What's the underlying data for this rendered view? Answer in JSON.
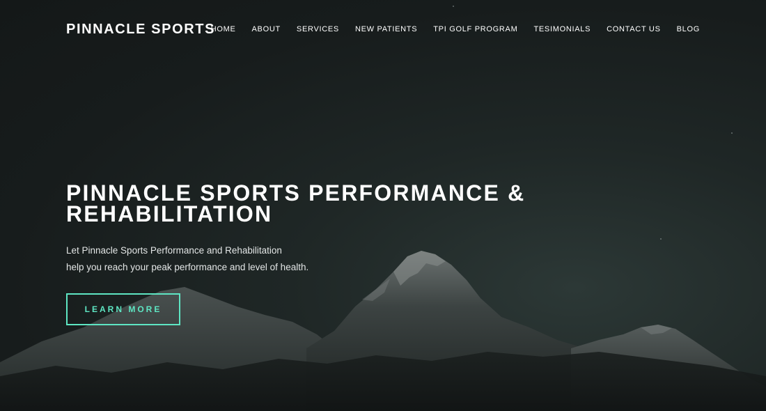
{
  "header": {
    "brand": "PINNACLE SPORTS"
  },
  "nav": {
    "items": [
      {
        "label": "HOME"
      },
      {
        "label": "ABOUT"
      },
      {
        "label": "SERVICES"
      },
      {
        "label": "NEW PATIENTS"
      },
      {
        "label": "TPI GOLF PROGRAM"
      },
      {
        "label": "TESIMONIALS"
      },
      {
        "label": "CONTACT US"
      },
      {
        "label": "BLOG"
      }
    ]
  },
  "hero": {
    "headline_line1": "PINNACLE SPORTS PERFORMANCE &",
    "headline_line2": "REHABILITATION",
    "tagline_line1": "Let Pinnacle Sports Performance and Rehabilitation",
    "tagline_line2": "help you reach your peak performance and level of health.",
    "cta_label": "LEARN MORE"
  },
  "colors": {
    "accent": "#5ee6c3",
    "background": "#171c1c",
    "text": "#ffffff"
  }
}
